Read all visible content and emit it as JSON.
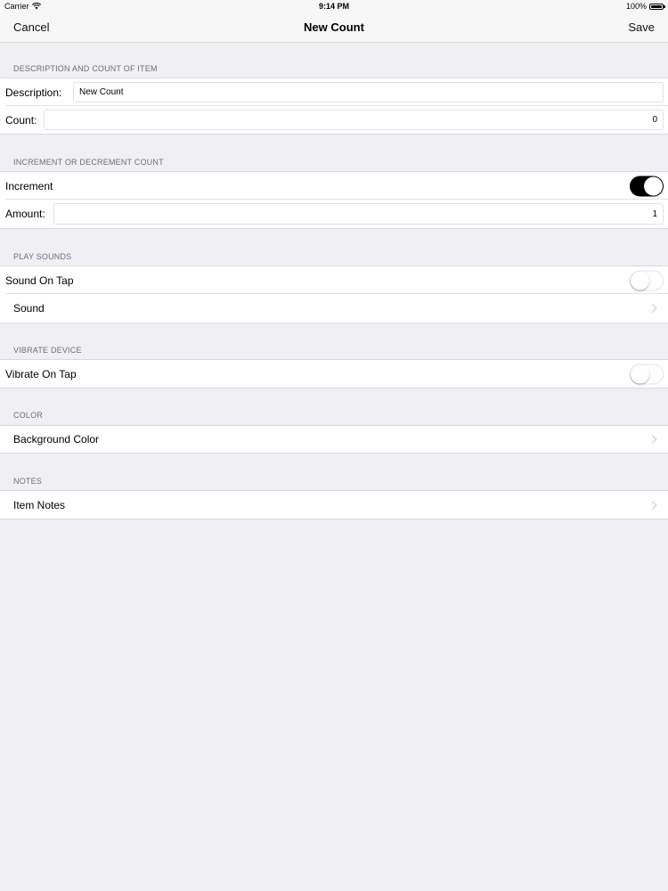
{
  "status_bar": {
    "carrier": "Carrier",
    "time": "9:14 PM",
    "battery": "100%"
  },
  "nav": {
    "cancel": "Cancel",
    "title": "New Count",
    "save": "Save"
  },
  "sections": {
    "description": {
      "header": "DESCRIPTION AND COUNT OF ITEM",
      "description_label": "Description:",
      "description_value": "New Count",
      "count_label": "Count:",
      "count_value": "0"
    },
    "increment": {
      "header": "INCREMENT OR DECREMENT COUNT",
      "increment_label": "Increment",
      "increment_on": true,
      "amount_label": "Amount:",
      "amount_value": "1"
    },
    "sounds": {
      "header": "PLAY SOUNDS",
      "sound_on_tap_label": "Sound On Tap",
      "sound_on_tap_on": false,
      "sound_label": "Sound"
    },
    "vibrate": {
      "header": "VIBRATE DEVICE",
      "vibrate_on_tap_label": "Vibrate On Tap",
      "vibrate_on_tap_on": false
    },
    "color": {
      "header": "COLOR",
      "background_color_label": "Background Color"
    },
    "notes": {
      "header": "NOTES",
      "item_notes_label": "Item Notes"
    }
  },
  "icons": {
    "wifi": "wifi-icon",
    "battery": "battery-icon",
    "chevron": "chevron-right-icon"
  },
  "colors": {
    "background": "#efeff4",
    "toggle_on": "#000000",
    "chevron": "#c7c7cc"
  }
}
